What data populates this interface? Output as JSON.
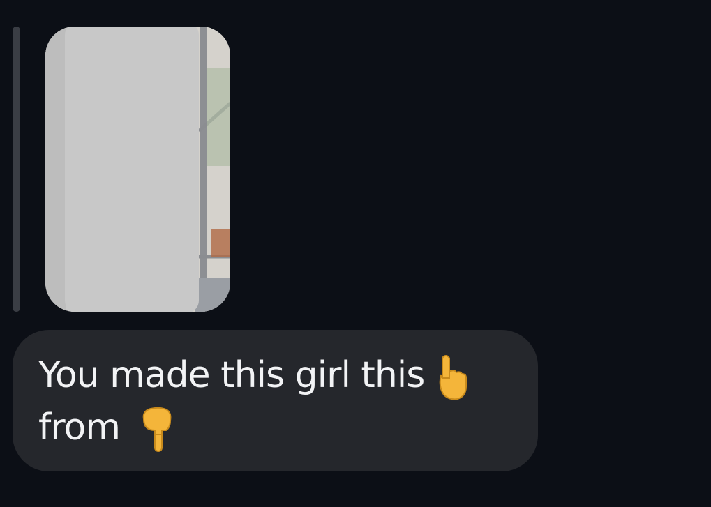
{
  "message": {
    "line1": "You made this girl this",
    "line2": "from",
    "emoji_up": "pointing-up-hand-icon",
    "emoji_down": "pointing-down-hand-icon"
  },
  "reply_media": {
    "type": "image",
    "state": "redacted"
  },
  "colors": {
    "background": "#0c0f16",
    "bubble": "#25272c",
    "text": "#f2f3f5",
    "reply_bar": "#3a3d44",
    "redaction": "#c8c8c8",
    "emoji": "#f4b53a"
  }
}
